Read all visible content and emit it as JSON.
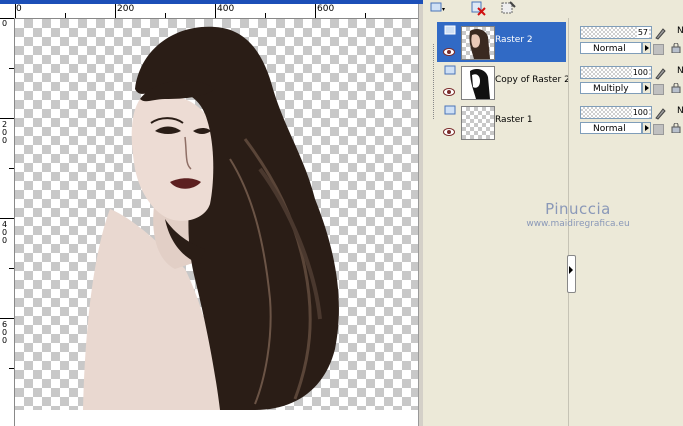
{
  "rulers": {
    "h_labels": [
      "0",
      "200",
      "400",
      "600"
    ],
    "v_labels": [
      "0",
      "2\n0\n0",
      "4\n0\n0",
      "6\n0\n0"
    ]
  },
  "layers": [
    {
      "name": "Raster 2",
      "selected": true,
      "opacity": "57",
      "blend": "Normal"
    },
    {
      "name": "Copy of Raster 2",
      "selected": false,
      "opacity": "100",
      "blend": "Multiply"
    },
    {
      "name": "Raster 1",
      "selected": false,
      "opacity": "100",
      "blend": "Normal"
    }
  ],
  "props_suffix": "N",
  "watermark": {
    "line1": "Pinuccia",
    "line2": "www.maidiregrafica.eu"
  },
  "colors": {
    "selection": "#316ac5",
    "panel": "#ece9d8",
    "hair": "#2a1d16",
    "skin": "#e9d8d0"
  }
}
